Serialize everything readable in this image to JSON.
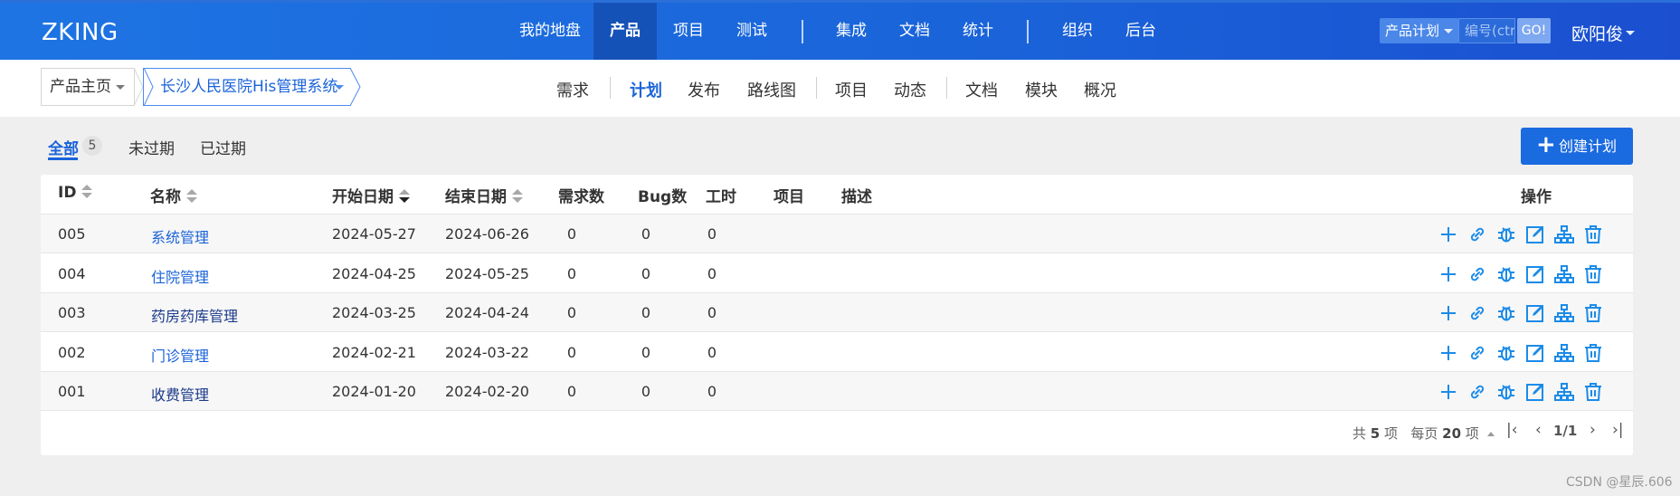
{
  "app": {
    "logo": "ZKING"
  },
  "main_nav": [
    {
      "label": "我的地盘",
      "active": false
    },
    {
      "label": "产品",
      "active": true
    },
    {
      "label": "项目",
      "active": false
    },
    {
      "label": "测试",
      "active": false
    },
    {
      "label": "集成",
      "active": false
    },
    {
      "label": "文档",
      "active": false
    },
    {
      "label": "统计",
      "active": false
    },
    {
      "label": "组织",
      "active": false
    },
    {
      "label": "后台",
      "active": false
    }
  ],
  "search": {
    "scope": "产品计划",
    "placeholder": "编号(ctrl+g)",
    "go_label": "GO!"
  },
  "user": {
    "name": "欧阳俊"
  },
  "breadcrumb": {
    "home": "产品主页",
    "product": "长沙人民医院His管理系统"
  },
  "sub_nav": [
    {
      "label": "需求",
      "active": false
    },
    {
      "label": "计划",
      "active": true
    },
    {
      "label": "发布",
      "active": false
    },
    {
      "label": "路线图",
      "active": false
    },
    {
      "label": "项目",
      "active": false
    },
    {
      "label": "动态",
      "active": false
    },
    {
      "label": "文档",
      "active": false
    },
    {
      "label": "模块",
      "active": false
    },
    {
      "label": "概况",
      "active": false
    }
  ],
  "filter_tabs": {
    "all": "全部",
    "all_count": "5",
    "unexpired": "未过期",
    "expired": "已过期"
  },
  "create_button": {
    "label": "创建计划"
  },
  "table": {
    "headers": {
      "id": "ID",
      "name": "名称",
      "start": "开始日期",
      "end": "结束日期",
      "stories": "需求数",
      "bugs": "Bug数",
      "hours": "工时",
      "project": "项目",
      "desc": "描述",
      "actions": "操作"
    },
    "rows": [
      {
        "id": "005",
        "name": "系统管理",
        "start": "2024-05-27",
        "end": "2024-06-26",
        "stories": "0",
        "bugs": "0",
        "hours": "0"
      },
      {
        "id": "004",
        "name": "住院管理",
        "start": "2024-04-25",
        "end": "2024-05-25",
        "stories": "0",
        "bugs": "0",
        "hours": "0"
      },
      {
        "id": "003",
        "name": "药房药库管理",
        "start": "2024-03-25",
        "end": "2024-04-24",
        "stories": "0",
        "bugs": "0",
        "hours": "0"
      },
      {
        "id": "002",
        "name": "门诊管理",
        "start": "2024-02-21",
        "end": "2024-03-22",
        "stories": "0",
        "bugs": "0",
        "hours": "0"
      },
      {
        "id": "001",
        "name": "收费管理",
        "start": "2024-01-20",
        "end": "2024-02-20",
        "stories": "0",
        "bugs": "0",
        "hours": "0"
      }
    ],
    "action_icons": [
      "plus-icon",
      "link-icon",
      "bug-icon",
      "edit-icon",
      "hierarchy-icon",
      "trash-icon"
    ]
  },
  "pager": {
    "total_prefix": "共",
    "total": "5",
    "total_suffix": "项",
    "per_page_prefix": "每页",
    "per_page": "20",
    "per_page_suffix": "项",
    "page": "1/1"
  },
  "watermark": "CSDN @星辰.606",
  "colors": {
    "primary": "#1a63d9",
    "header": "#1e6ae0",
    "icon": "#1b8be8"
  }
}
